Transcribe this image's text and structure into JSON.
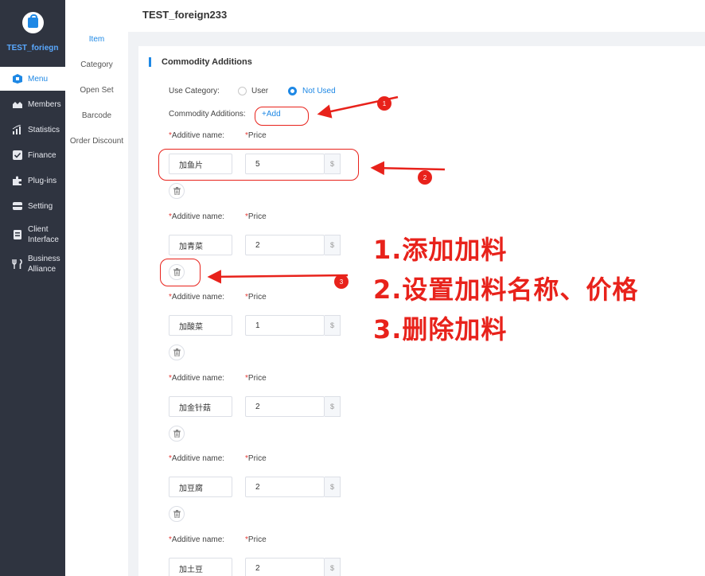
{
  "sidebar": {
    "brand": "TEST_foriegn",
    "items": [
      {
        "label": "Menu",
        "icon": "menu-icon"
      },
      {
        "label": "Members",
        "icon": "members-icon"
      },
      {
        "label": "Statistics",
        "icon": "statistics-icon"
      },
      {
        "label": "Finance",
        "icon": "finance-icon"
      },
      {
        "label": "Plug-ins",
        "icon": "plugin-icon"
      },
      {
        "label": "Setting",
        "icon": "setting-icon"
      },
      {
        "label": "Client Interface",
        "icon": "client-icon"
      },
      {
        "label": "Business Alliance",
        "icon": "alliance-icon"
      }
    ]
  },
  "submenu": [
    "Item",
    "Category",
    "Open Set",
    "Barcode",
    "Order Discount"
  ],
  "header": {
    "title": "TEST_foreign233"
  },
  "section": {
    "title": "Commodity Additions"
  },
  "use_category": {
    "label": "Use Category:",
    "options": [
      "User",
      "Not Used"
    ],
    "selected": "Not Used"
  },
  "commodity_additions": {
    "label": "Commodity Additions:",
    "add_label": "+Add"
  },
  "field_labels": {
    "name": "Additive name:",
    "price": "Price",
    "required_mark": "*",
    "currency": "$"
  },
  "additives": [
    {
      "name": "加鱼片",
      "price": "5"
    },
    {
      "name": "加青菜",
      "price": "2"
    },
    {
      "name": "加酸菜",
      "price": "1"
    },
    {
      "name": "加金针菇",
      "price": "2"
    },
    {
      "name": "加豆腐",
      "price": "2"
    },
    {
      "name": "加土豆",
      "price": "2"
    }
  ],
  "annotations": {
    "badges": [
      "1",
      "2",
      "3"
    ],
    "notes": [
      "1.添加加料",
      "2.设置加料名称、价格",
      "3.删除加料"
    ],
    "color": "#e8221b"
  },
  "colors": {
    "accent": "#1e88e5",
    "sidebar": "#2f3440"
  }
}
